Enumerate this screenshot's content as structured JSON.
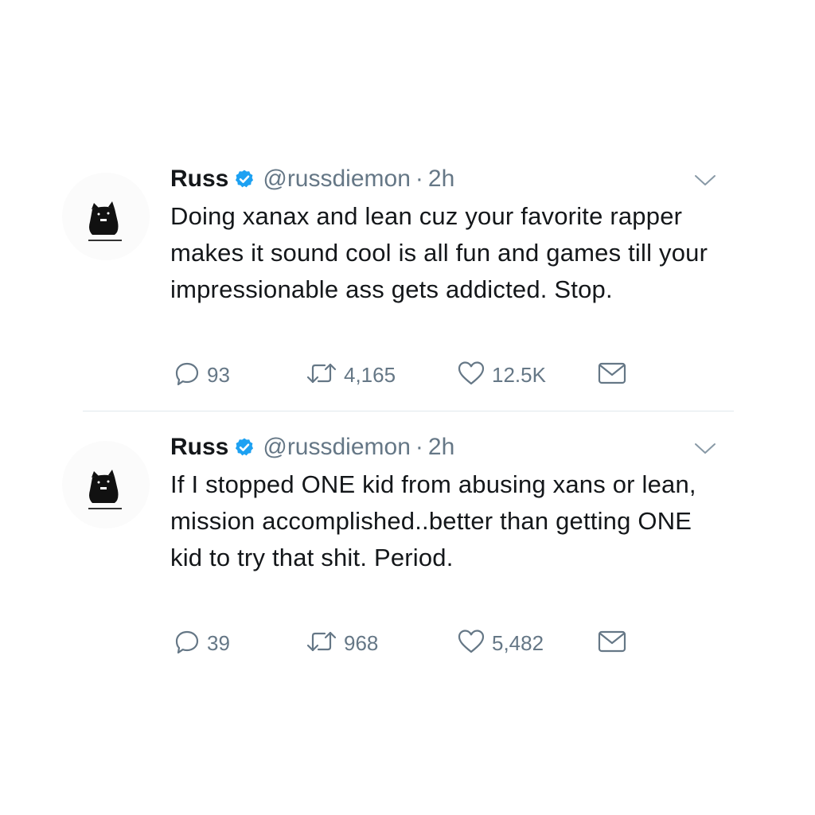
{
  "colors": {
    "text": "#14171a",
    "secondary": "#657786",
    "verified_blue": "#1da1f2",
    "divider": "#e1e8ed"
  },
  "tweets": [
    {
      "name": "Russ",
      "handle": "@russdiemon",
      "separator": "·",
      "time": "2h",
      "text": "Doing xanax and lean cuz your favorite rapper makes it sound cool is all fun and games till your impressionable ass gets addicted. Stop.",
      "replies": "93",
      "retweets": "4,165",
      "likes": "12.5K",
      "icons": [
        "verified-badge-icon",
        "chevron-down-icon",
        "reply-icon",
        "retweet-icon",
        "like-heart-icon",
        "direct-message-icon"
      ]
    },
    {
      "name": "Russ",
      "handle": "@russdiemon",
      "separator": "·",
      "time": "2h",
      "text": "If I stopped ONE kid from abusing xans or lean, mission accomplished..better than getting ONE kid to try that shit. Period.",
      "replies": "39",
      "retweets": "968",
      "likes": "5,482",
      "icons": [
        "verified-badge-icon",
        "chevron-down-icon",
        "reply-icon",
        "retweet-icon",
        "like-heart-icon",
        "direct-message-icon"
      ]
    }
  ]
}
